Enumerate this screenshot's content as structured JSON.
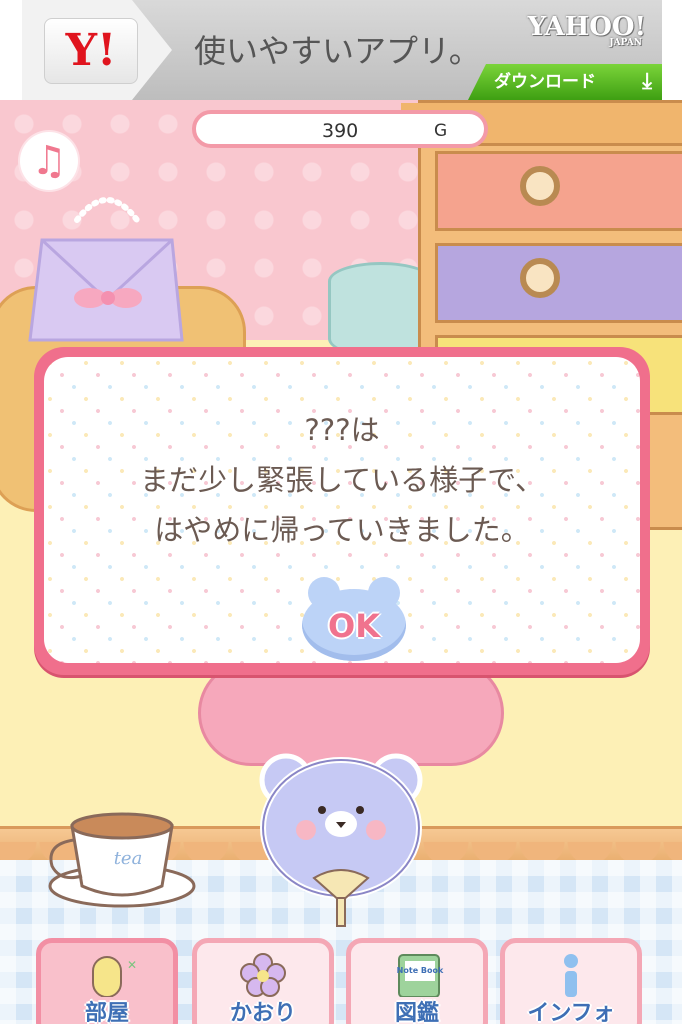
{
  "ad": {
    "logo": "Y!",
    "headline": "使いやすいアプリ。",
    "brand": "YAHOO!",
    "brand_sub": "JAPAN",
    "download_label": "ダウンロード",
    "download_icon": "download-icon"
  },
  "status": {
    "gold_amount": "390",
    "gold_unit": "G"
  },
  "music_icon": "music-note-icon",
  "dialog": {
    "lines": [
      "???は",
      "まだ少し緊張している様子で、",
      "はやめに帰っていきました。"
    ],
    "ok_label": "OK"
  },
  "nav": {
    "items": [
      {
        "label": "部屋",
        "icon": "room-door-icon",
        "active": true
      },
      {
        "label": "かおり",
        "icon": "flower-icon",
        "active": false
      },
      {
        "label": "図鑑",
        "icon": "notebook-icon",
        "icon_text": "Note Book",
        "active": false
      },
      {
        "label": "インフォ",
        "icon": "info-icon",
        "active": false
      }
    ]
  },
  "decor": {
    "teacup_text": "tea"
  },
  "colors": {
    "dialog_border": "#f06f8c",
    "nav_label": "#3e6fb5",
    "ok_text": "#f0738e"
  }
}
